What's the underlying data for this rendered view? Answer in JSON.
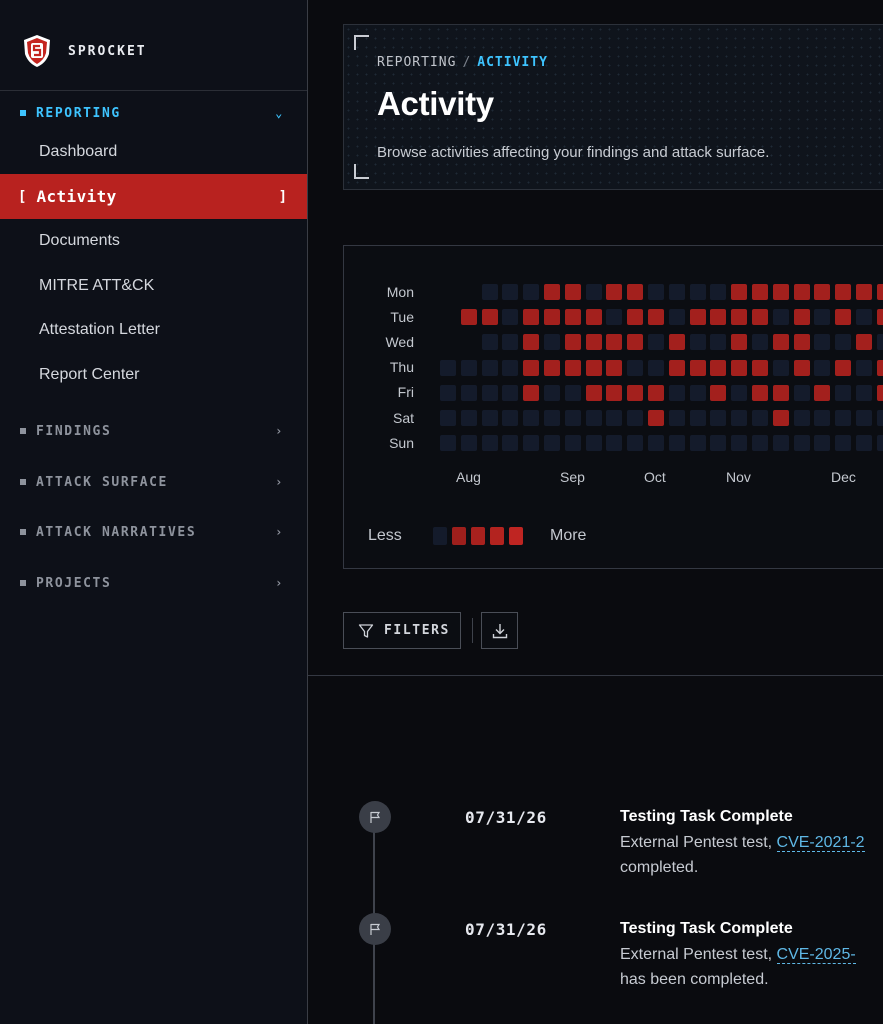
{
  "brand": {
    "name": "SPROCKET"
  },
  "sidebar": {
    "sections": [
      {
        "label": "REPORTING",
        "expanded": true
      },
      {
        "label": "FINDINGS",
        "expanded": false
      },
      {
        "label": "ATTACK SURFACE",
        "expanded": false
      },
      {
        "label": "ATTACK NARRATIVES",
        "expanded": false
      },
      {
        "label": "PROJECTS",
        "expanded": false
      }
    ],
    "reporting_items": [
      {
        "label": "Dashboard"
      },
      {
        "label": "Activity",
        "active": true
      },
      {
        "label": "Documents"
      },
      {
        "label": "MITRE ATT&CK"
      },
      {
        "label": "Attestation Letter"
      },
      {
        "label": "Report Center"
      }
    ],
    "active_bracket_open": "[",
    "active_bracket_close": "]"
  },
  "header": {
    "breadcrumb_parent": "REPORTING",
    "breadcrumb_sep": "/",
    "breadcrumb_current": "ACTIVITY",
    "title": "Activity",
    "subtitle": "Browse activities affecting your findings and attack surface."
  },
  "heatmap": {
    "days": [
      "Mon",
      "Tue",
      "Wed",
      "Thu",
      "Fri",
      "Sat",
      "Sun"
    ],
    "months": [
      "Aug",
      "Sep",
      "Oct",
      "Nov",
      "Dec"
    ],
    "legend_less": "Less",
    "legend_more": "More",
    "colors": {
      "empty": "#141b2b",
      "active": "#a3201d",
      "legend": [
        "#141b2b",
        "#9e1f1c",
        "#a8211e",
        "#b3231f",
        "#bf2522"
      ]
    },
    "grid": [
      "..000110110000111111111111",
      ".1101111011011110101011111",
      "..0010111101001011001011111",
      "0000111110011111010101111",
      "0000100111100101101001000",
      "0000000000100000100000000",
      "0000000000000000000000000"
    ]
  },
  "toolbar": {
    "filters_label": "FILTERS"
  },
  "timeline": [
    {
      "date": "07/31/26",
      "title": "Testing Task Complete",
      "desc_prefix": "External Pentest test, ",
      "link": "CVE-2021-2",
      "desc_suffix": "completed."
    },
    {
      "date": "07/31/26",
      "title": "Testing Task Complete",
      "desc_prefix": "External Pentest test, ",
      "link": "CVE-2025-",
      "desc_suffix": "has been completed."
    }
  ]
}
